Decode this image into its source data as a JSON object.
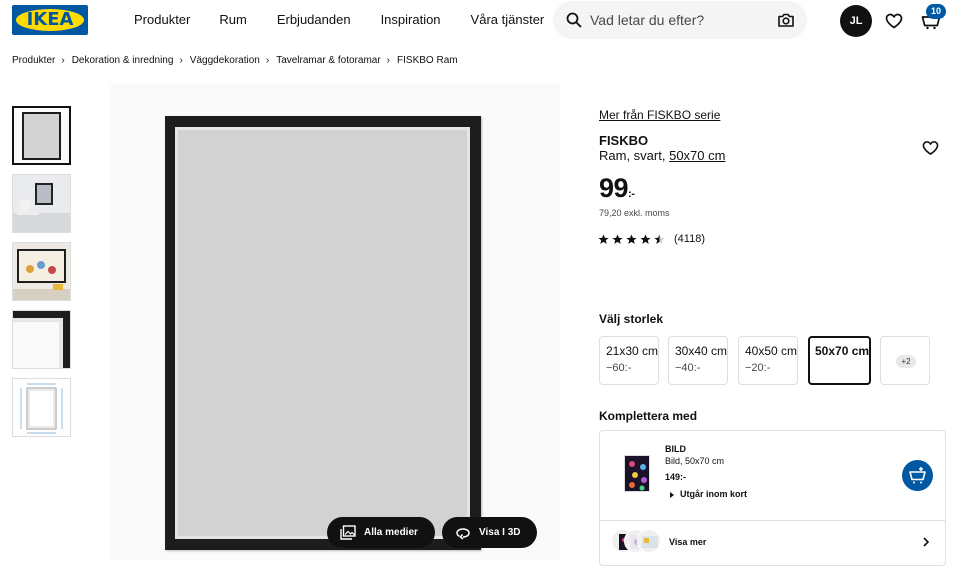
{
  "header": {
    "logo_text": "IKEA",
    "nav": [
      "Produkter",
      "Rum",
      "Erbjudanden",
      "Inspiration",
      "Våra tjänster"
    ],
    "search_placeholder": "Vad letar du efter?",
    "avatar_initials": "JL",
    "cart_count": "10",
    "colors": {
      "brand_blue": "#0058a3",
      "brand_yellow": "#ffdb00"
    }
  },
  "breadcrumb": [
    "Produkter",
    "Dekoration & inredning",
    "Väggdekoration",
    "Tavelramar & fotoramar",
    "FISKBO Ram"
  ],
  "gallery": {
    "thumbnail_count": 5,
    "buttons": {
      "all_media": "Alla medier",
      "view_3d": "Visa I 3D"
    }
  },
  "product": {
    "series_link": "Mer från FISKBO serie",
    "name": "FISKBO",
    "desc_prefix": "Ram, svart,",
    "desc_size": "50x70 cm",
    "price": "99",
    "price_suffix": ":-",
    "price_excl": "79,20 exkl. moms",
    "rating": 4.5,
    "rating_count": "(4118)"
  },
  "sizes": {
    "title": "Välj storlek",
    "options": [
      {
        "size": "21x30 cm",
        "price": "−60:-"
      },
      {
        "size": "30x40 cm",
        "price": "−40:-"
      },
      {
        "size": "40x50 cm",
        "price": "−20:-"
      },
      {
        "size": "50x70 cm",
        "price": ""
      }
    ],
    "selected": "50x70 cm",
    "more": "+2"
  },
  "complement": {
    "title": "Komplettera med",
    "item": {
      "name": "BILD",
      "desc": "Bild, 50x70 cm",
      "price": "149:-",
      "availability": "Utgår inom kort"
    },
    "show_more": "Visa mer"
  }
}
